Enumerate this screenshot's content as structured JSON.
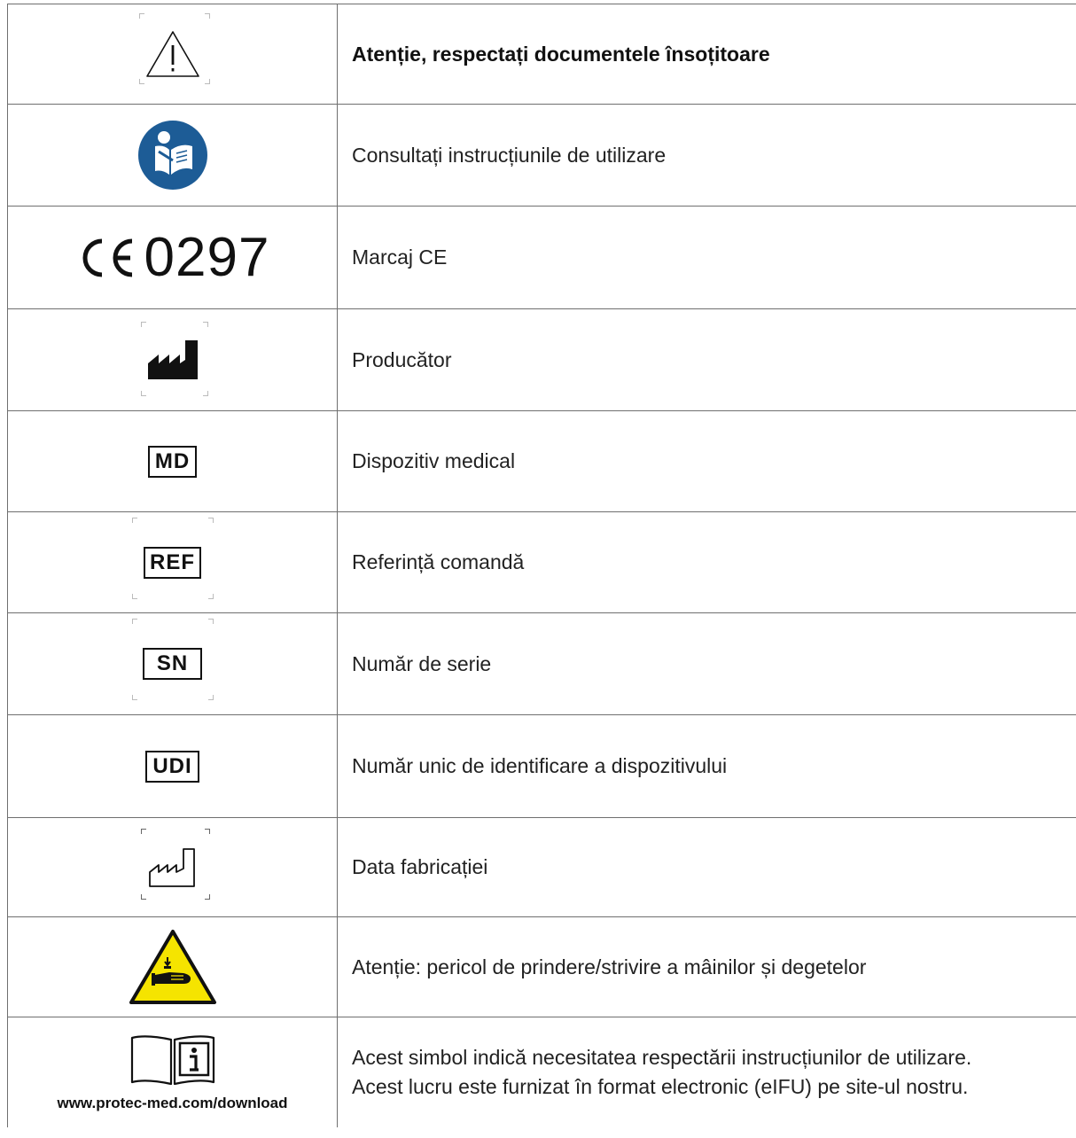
{
  "rows": [
    {
      "icon": "warning-triangle-icon",
      "text": "Atenție, respectați documentele însoțitoare"
    },
    {
      "icon": "read-manual-icon",
      "text": "Consultați instrucțiunile de utilizare"
    },
    {
      "icon": "ce-mark-icon",
      "symbol": "0297",
      "text": "Marcaj CE"
    },
    {
      "icon": "manufacturer-icon",
      "text": "Producător"
    },
    {
      "icon": "md-box-icon",
      "symbol": "MD",
      "text": "Dispozitiv medical"
    },
    {
      "icon": "ref-box-icon",
      "symbol": "REF",
      "text": "Referință comandă"
    },
    {
      "icon": "sn-box-icon",
      "symbol": "SN",
      "text": "Număr de serie"
    },
    {
      "icon": "udi-box-icon",
      "symbol": "UDI",
      "text": "Număr unic de identificare a dispozitivului"
    },
    {
      "icon": "manufacture-date-icon",
      "text": "Data fabricației"
    },
    {
      "icon": "hand-crush-warning-icon",
      "text": "Atenție: pericol de prindere/strivire a mâinilor și degetelor"
    },
    {
      "icon": "eifu-book-icon",
      "url": "www.protec-med.com/download",
      "text_line1": "Acest simbol indică necesitatea respectării instrucțiunilor de utilizare.",
      "text_line2": "Acest lucru este furnizat în format electronic (eIFU) pe site-ul nostru."
    }
  ],
  "colors": {
    "info_blue": "#1d5c96",
    "warning_yellow": "#f5e400",
    "border": "#6f6f6f"
  }
}
